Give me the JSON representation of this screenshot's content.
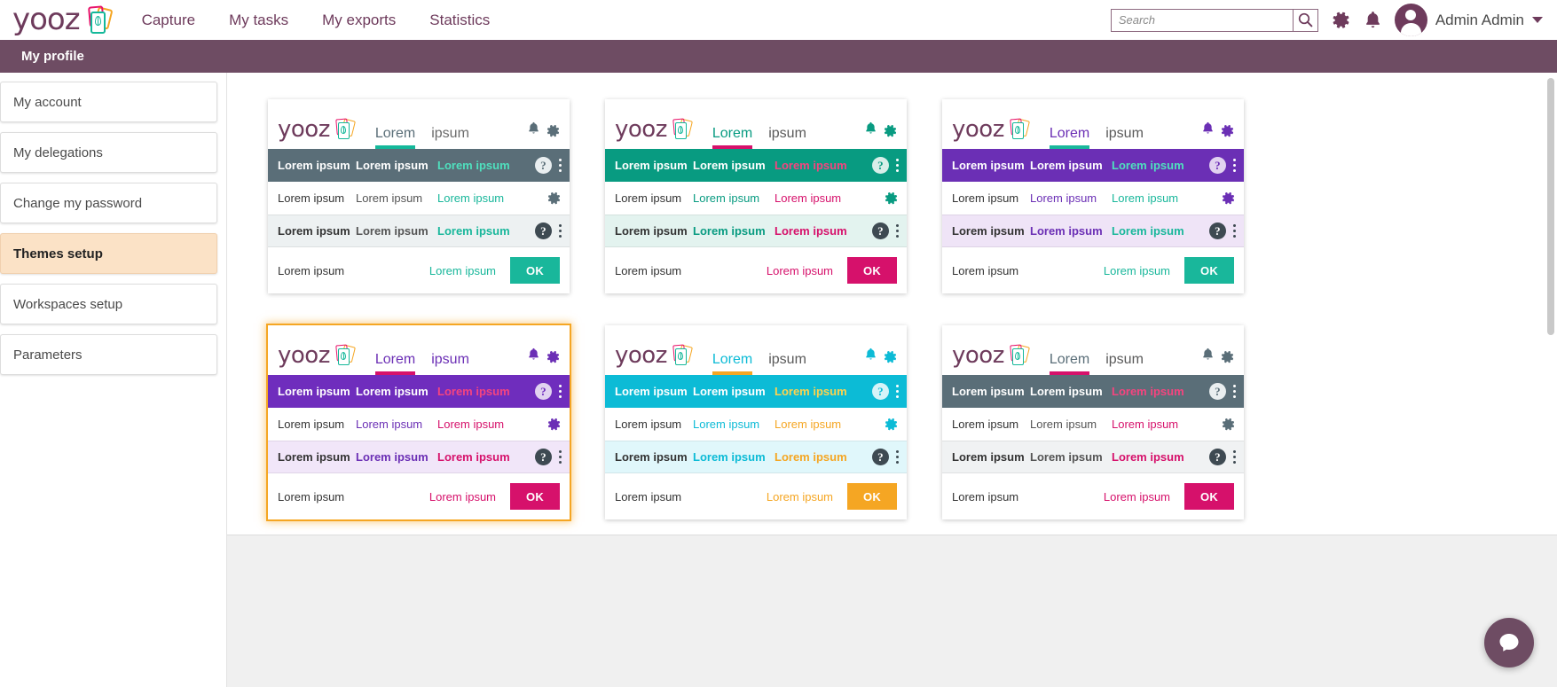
{
  "header": {
    "brand_text": "yooz",
    "nav": [
      {
        "label": "Capture"
      },
      {
        "label": "My tasks"
      },
      {
        "label": "My exports"
      },
      {
        "label": "Statistics"
      }
    ],
    "search": {
      "placeholder": "Search",
      "value": ""
    },
    "search_icon": "search-icon",
    "gear_icon": "gear-icon",
    "bell_icon": "bell-icon",
    "user_name": "Admin Admin",
    "brand_color": "#6E3B5C"
  },
  "subbar": {
    "title": "My profile",
    "bg": "#6E4C63"
  },
  "sidebar": {
    "items": [
      {
        "label": "My account",
        "active": false
      },
      {
        "label": "My delegations",
        "active": false
      },
      {
        "label": "Change my password",
        "active": false
      },
      {
        "label": "Themes setup",
        "active": true
      },
      {
        "label": "Workspaces setup",
        "active": false
      },
      {
        "label": "Parameters",
        "active": false
      }
    ],
    "active_bg": "#FBE2C6"
  },
  "card_common": {
    "brand_text": "yooz",
    "tab_active": "Lorem",
    "tab_inactive": "ipsum",
    "cell_text": "Lorem ipsum",
    "ok_label": "OK",
    "help_glyph": "?",
    "bell_icon": "bell-icon",
    "gear_icon": "gear-icon",
    "help_icon": "help-icon",
    "kebab_icon": "more-vertical-icon"
  },
  "themes": [
    {
      "name": "theme-grey-teal",
      "selected": false,
      "header_bg": "#5A6E78",
      "tab_text": "#5A6E78",
      "tab_underline": "#14B89A",
      "tab_inactive_text": "#6b6b6b",
      "accent": "#19B79B",
      "col1": "#333333",
      "col2": "#555555",
      "col3": "#19B79B",
      "head_col3": "#4FE0BE",
      "alt_row_bg": "#EDF1F2",
      "icon_color": "#5A6E78",
      "head_icon_color": "#E9EEF0",
      "btn_bg": "#19B79B",
      "foot_text": "#19B79B"
    },
    {
      "name": "theme-green-pink",
      "selected": false,
      "header_bg": "#089B81",
      "tab_text": "#089B81",
      "tab_underline": "#D6116B",
      "tab_inactive_text": "#5a5a5a",
      "accent": "#D6116B",
      "col1": "#333333",
      "col2": "#089B81",
      "col3": "#D6116B",
      "head_col3": "#F5447F",
      "alt_row_bg": "#E3F3EF",
      "icon_color": "#089B81",
      "head_icon_color": "#D8EEE9",
      "btn_bg": "#D6116B",
      "foot_text": "#D6116B"
    },
    {
      "name": "theme-purple-teal",
      "selected": false,
      "header_bg": "#6B2FB5",
      "tab_text": "#6B2FB5",
      "tab_underline": "#19B79B",
      "tab_inactive_text": "#5a5a5a",
      "accent": "#19B79B",
      "col1": "#333333",
      "col2": "#6B2FB5",
      "col3": "#19B79B",
      "head_col3": "#4FE0BE",
      "alt_row_bg": "#EFE4F7",
      "icon_color": "#6B2FB5",
      "head_icon_color": "#E1D2F0",
      "btn_bg": "#19B79B",
      "foot_text": "#19B79B"
    },
    {
      "name": "theme-violet-pink",
      "selected": true,
      "header_bg": "#6F2DBD",
      "tab_text": "#6B2FB5",
      "tab_underline": "#D6116B",
      "tab_inactive_text": "#6B2FB5",
      "accent": "#D6116B",
      "col1": "#333333",
      "col2": "#6B2FB5",
      "col3": "#D6116B",
      "head_col3": "#F5447F",
      "alt_row_bg": "#F1E6F9",
      "icon_color": "#6B2FB5",
      "head_icon_color": "#E1D2F0",
      "btn_bg": "#D6116B",
      "foot_text": "#D6116B"
    },
    {
      "name": "theme-cyan-orange",
      "selected": false,
      "header_bg": "#0CBBD6",
      "tab_text": "#0CBBD6",
      "tab_underline": "#F5A623",
      "tab_inactive_text": "#5a5a5a",
      "accent": "#F5A623",
      "col1": "#333333",
      "col2": "#0CBBD6",
      "col3": "#F5A623",
      "head_col3": "#FFD34D",
      "alt_row_bg": "#E0F7FB",
      "icon_color": "#0CBBD6",
      "head_icon_color": "#D6F3F8",
      "btn_bg": "#F5A623",
      "foot_text": "#F5A623"
    },
    {
      "name": "theme-grey-pink",
      "selected": false,
      "header_bg": "#5A6E78",
      "tab_text": "#5A6E78",
      "tab_underline": "#D6116B",
      "tab_inactive_text": "#5a5a5a",
      "accent": "#D6116B",
      "col1": "#333333",
      "col2": "#555555",
      "col3": "#D6116B",
      "head_col3": "#F5447F",
      "alt_row_bg": "#F0F2F3",
      "icon_color": "#5A6E78",
      "head_icon_color": "#E9EEF0",
      "btn_bg": "#D6116B",
      "foot_text": "#D6116B"
    }
  ],
  "chat": {
    "icon": "chat-icon"
  }
}
